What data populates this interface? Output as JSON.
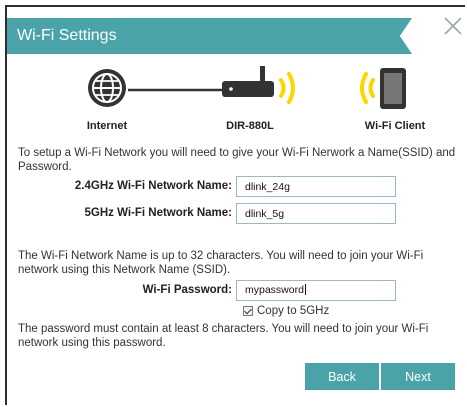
{
  "window": {
    "title": "Wi-Fi Settings"
  },
  "diagram": {
    "internet_label": "Internet",
    "router_label": "DIR-880L",
    "client_label": "Wi-Fi Client"
  },
  "intro_text": "To setup a Wi-Fi Network you will need to give your Wi-Fi Nerwork a Name(SSID) and Password.",
  "fields": {
    "ssid_24": {
      "label": "2.4GHz Wi-Fi Network Name:",
      "value": "dlink_24g"
    },
    "ssid_5": {
      "label": "5GHz Wi-Fi Network Name:",
      "value": "dlink_5g"
    },
    "password": {
      "label": "Wi-Fi Password:",
      "value": "mypassword"
    }
  },
  "ssid_help_text": "The Wi-Fi Network Name is up to 32 characters. You will need to join your Wi-Fi network using this Network Name (SSID).",
  "copy_to_5ghz": {
    "label": "Copy to 5GHz",
    "checked": true
  },
  "password_help_text": "The password must contain at least 8 characters. You will need to join your Wi-Fi network using this password.",
  "buttons": {
    "back": "Back",
    "next": "Next"
  },
  "colors": {
    "accent": "#4aa3a9",
    "signal": "#ffd400",
    "icon_dark": "#333333"
  },
  "icons": [
    "close-icon",
    "globe-icon",
    "router-icon",
    "wifi-signal-icon",
    "tablet-icon"
  ]
}
